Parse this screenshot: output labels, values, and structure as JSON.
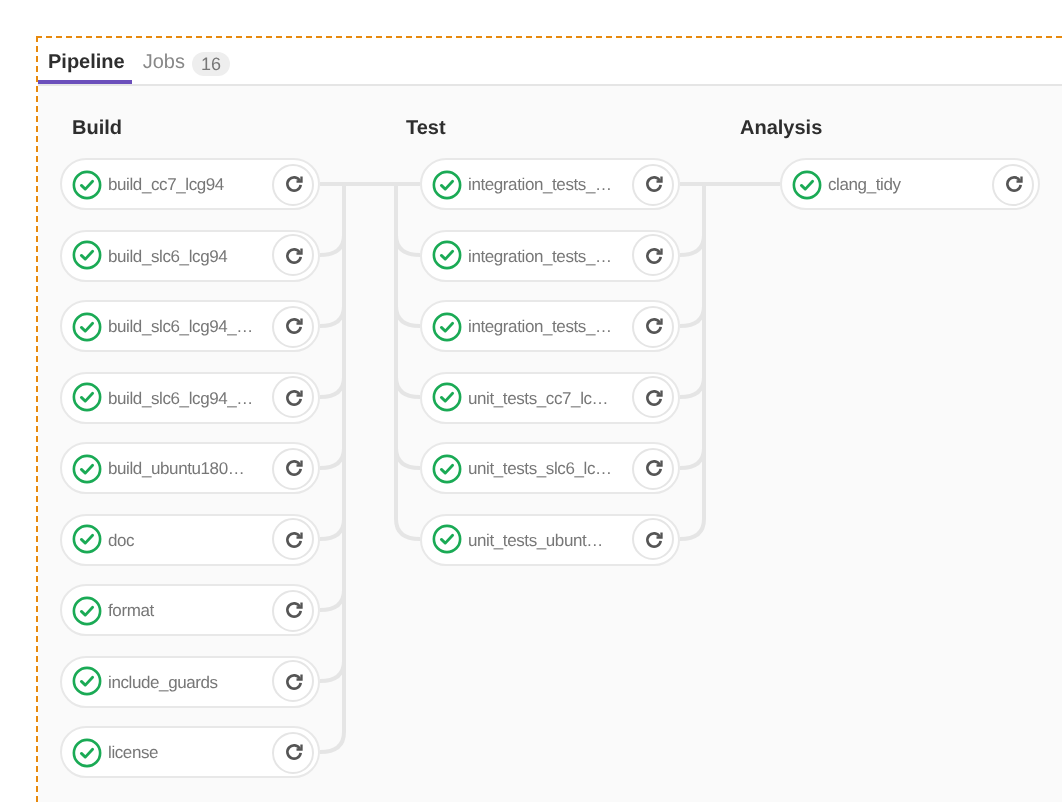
{
  "tabs": [
    {
      "label": "Pipeline",
      "selected": true
    },
    {
      "label": "Jobs",
      "count": "16",
      "selected": false
    }
  ],
  "stages": [
    {
      "name": "Build",
      "jobs": [
        {
          "name": "build_cc7_lcg94",
          "kind": "success"
        },
        {
          "name": "build_slc6_lcg94",
          "kind": "success"
        },
        {
          "name": "build_slc6_lcg94_…",
          "kind": "success"
        },
        {
          "name": "build_slc6_lcg94_…",
          "kind": "success"
        },
        {
          "name": "build_ubuntu180…",
          "kind": "success"
        },
        {
          "name": "doc",
          "kind": "success"
        },
        {
          "name": "format",
          "kind": "success"
        },
        {
          "name": "include_guards",
          "kind": "success"
        },
        {
          "name": "license",
          "kind": "success"
        }
      ]
    },
    {
      "name": "Test",
      "jobs": [
        {
          "name": "integration_tests_…",
          "kind": "success"
        },
        {
          "name": "integration_tests_…",
          "kind": "success"
        },
        {
          "name": "integration_tests_…",
          "kind": "success"
        },
        {
          "name": "unit_tests_cc7_lc…",
          "kind": "success"
        },
        {
          "name": "unit_tests_slc6_lc…",
          "kind": "success"
        },
        {
          "name": "unit_tests_ubunt…",
          "kind": "success"
        }
      ]
    },
    {
      "name": "Analysis",
      "jobs": [
        {
          "name": "clang_tidy",
          "kind": "success"
        }
      ]
    }
  ]
}
